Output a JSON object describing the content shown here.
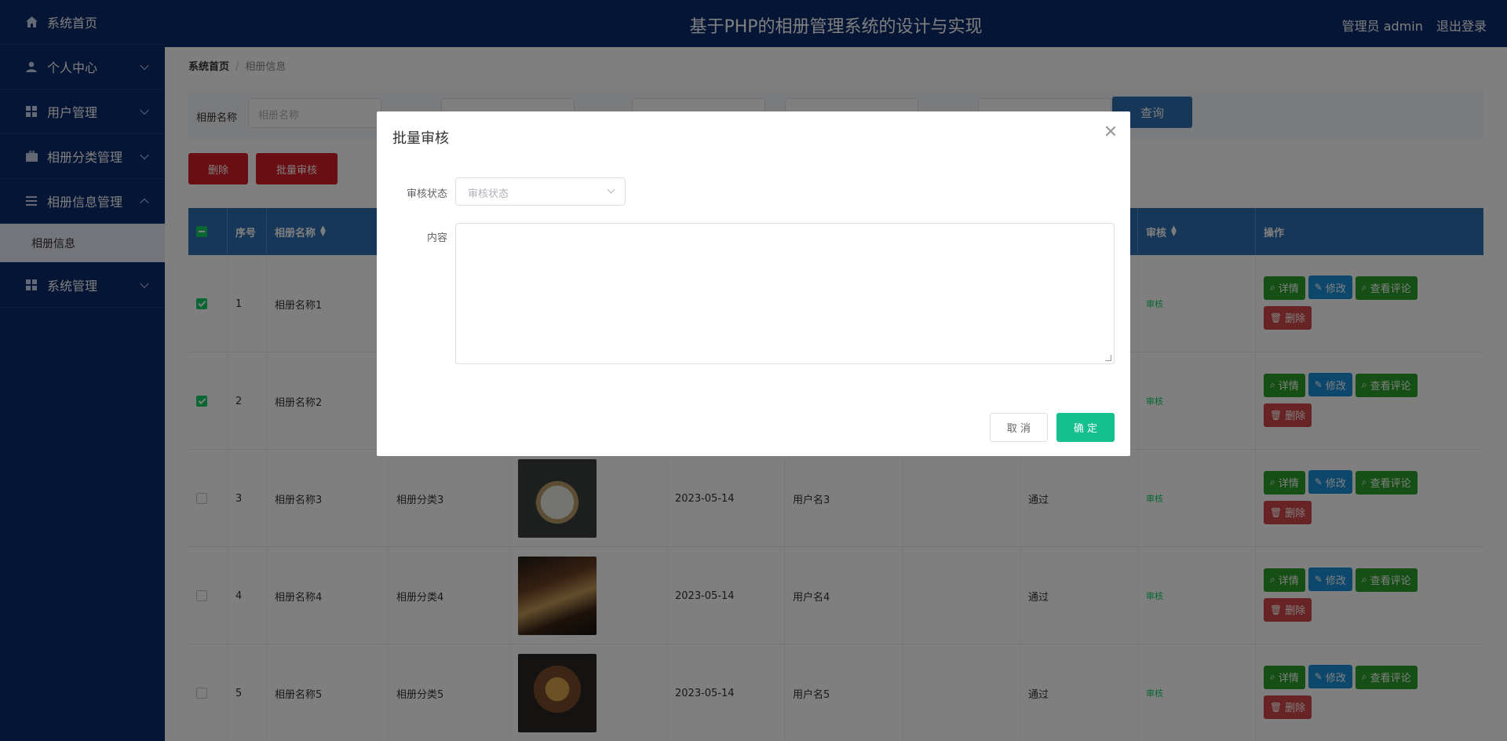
{
  "app": {
    "title": "基于PHP的相册管理系统的设计与实现",
    "user_label": "管理员 admin",
    "logout": "退出登录"
  },
  "sidebar": {
    "items": [
      {
        "label": "系统首页",
        "icon": "home-icon"
      },
      {
        "label": "个人中心",
        "icon": "user-icon"
      },
      {
        "label": "用户管理",
        "icon": "grid-icon"
      },
      {
        "label": "相册分类管理",
        "icon": "briefcase-icon"
      },
      {
        "label": "相册信息管理",
        "icon": "list-icon"
      },
      {
        "label": "系统管理",
        "icon": "grid-icon"
      }
    ],
    "sub_item": "相册信息"
  },
  "breadcrumb": {
    "home": "系统首页",
    "current": "相册信息"
  },
  "search": {
    "name_label": "相册名称",
    "name_placeholder": "相册名称",
    "query_button": "查询"
  },
  "toolbar": {
    "delete": "删除",
    "batch_audit": "批量审核"
  },
  "table": {
    "headers": {
      "index": "序号",
      "name": "相册名称",
      "audit": "审核",
      "ops": "操作"
    },
    "rows": [
      {
        "index": "1",
        "name": "相册名称1",
        "category": "",
        "date": "",
        "user": "",
        "status": "",
        "audit": "审核",
        "checked": true
      },
      {
        "index": "2",
        "name": "相册名称2",
        "category": "",
        "date": "",
        "user": "",
        "status": "",
        "audit": "审核",
        "checked": true
      },
      {
        "index": "3",
        "name": "相册名称3",
        "category": "相册分类3",
        "date": "2023-05-14",
        "user": "用户名3",
        "status": "通过",
        "audit": "审核",
        "checked": false
      },
      {
        "index": "4",
        "name": "相册名称4",
        "category": "相册分类4",
        "date": "2023-05-14",
        "user": "用户名4",
        "status": "通过",
        "audit": "审核",
        "checked": false
      },
      {
        "index": "5",
        "name": "相册名称5",
        "category": "相册分类5",
        "date": "2023-05-14",
        "user": "用户名5",
        "status": "通过",
        "audit": "审核",
        "checked": false
      }
    ],
    "actions": {
      "detail": "详情",
      "edit": "修改",
      "comments": "查看评论",
      "delete": "删除"
    }
  },
  "dialog": {
    "title": "批量审核",
    "status_label": "审核状态",
    "status_placeholder": "审核状态",
    "content_label": "内容",
    "cancel": "取 消",
    "confirm": "确 定"
  },
  "colors": {
    "nav_bg": "#0a2a6b",
    "table_head": "#2f6fb0",
    "danger": "#d21f26",
    "confirm": "#13c08e",
    "success": "#2c9f2c",
    "primary": "#1a8fd6"
  }
}
